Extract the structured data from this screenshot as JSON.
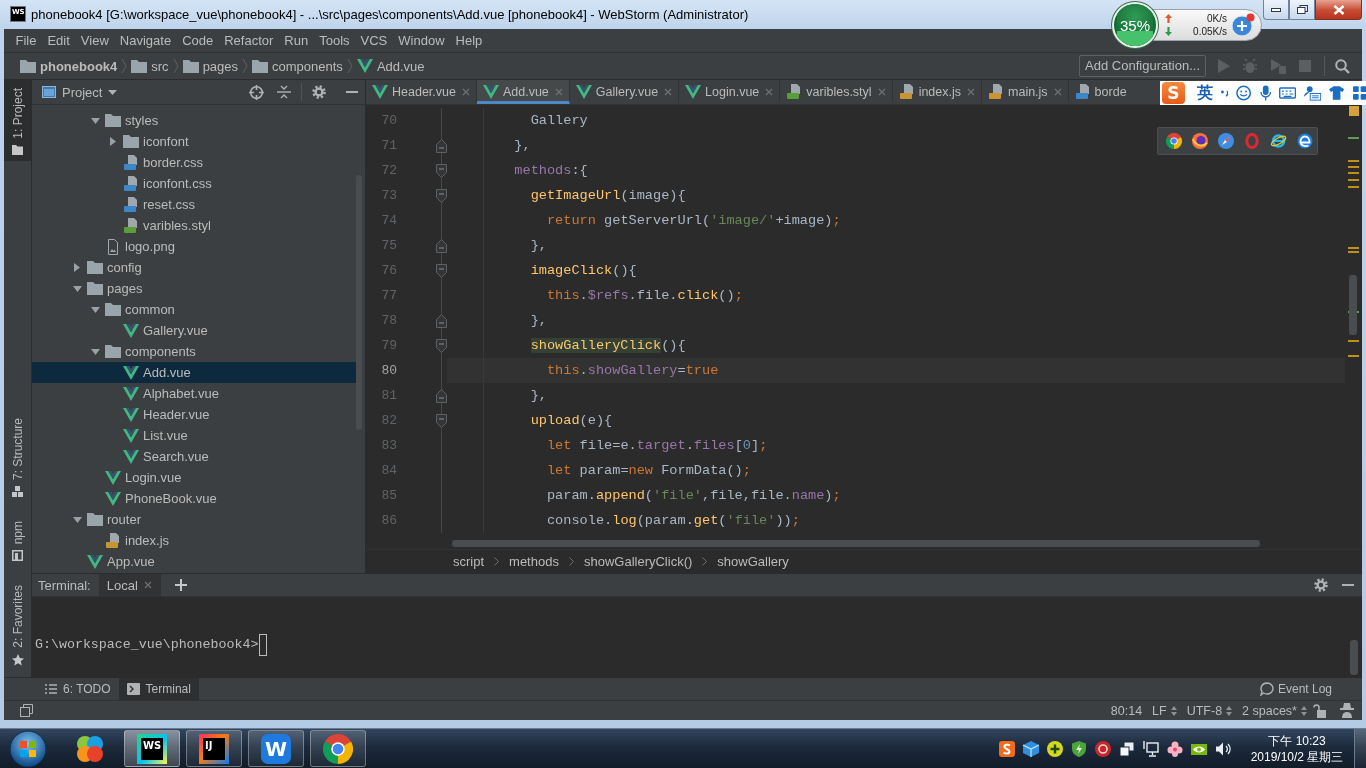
{
  "window": {
    "app_logo": "WS",
    "title": "phonebook4 [G:\\workspace_vue\\phonebook4] - ...\\src\\pages\\components\\Add.vue [phonebook4] - WebStorm (Administrator)"
  },
  "network_monitor": {
    "usage": "35%",
    "level": 0.35,
    "upload": "0K/s",
    "download": "0.05K/s"
  },
  "menu": [
    "File",
    "Edit",
    "View",
    "Navigate",
    "Code",
    "Refactor",
    "Run",
    "Tools",
    "VCS",
    "Window",
    "Help"
  ],
  "navigation_bar": {
    "breadcrumbs": [
      {
        "label": "phonebook4",
        "kind": "project"
      },
      {
        "label": "src",
        "kind": "folder"
      },
      {
        "label": "pages",
        "kind": "folder"
      },
      {
        "label": "components",
        "kind": "folder"
      },
      {
        "label": "Add.vue",
        "kind": "vue"
      }
    ],
    "run_configuration": "Add Configuration..."
  },
  "left_stripe": {
    "top": [
      {
        "label": "1: Project",
        "kind": "project",
        "selected": true
      }
    ],
    "bottom": [
      {
        "label": "7: Structure",
        "kind": "structure",
        "selected": false
      },
      {
        "label": "npm",
        "kind": "npm",
        "selected": false
      },
      {
        "label": "2: Favorites",
        "kind": "favorites",
        "selected": false
      }
    ]
  },
  "project_panel": {
    "title": "Project",
    "tree": [
      {
        "children": [
          {
            "label": "styles",
            "kind": "folder",
            "expanded": true,
            "selected": false,
            "children": [
              {
                "label": "iconfont",
                "kind": "folder",
                "expanded": false,
                "selected": false
              },
              {
                "label": "border.css",
                "kind": "css",
                "selected": false
              },
              {
                "label": "iconfont.css",
                "kind": "css",
                "selected": false
              },
              {
                "label": "reset.css",
                "kind": "css",
                "selected": false
              },
              {
                "label": "varibles.styl",
                "kind": "styl",
                "selected": false
              }
            ]
          },
          {
            "label": "logo.png",
            "kind": "image",
            "selected": false
          }
        ]
      },
      {
        "label": "config",
        "kind": "folder",
        "expanded": false,
        "selected": false
      },
      {
        "label": "pages",
        "kind": "folder",
        "expanded": true,
        "selected": false,
        "children": [
          {
            "label": "common",
            "kind": "folder",
            "expanded": true,
            "selected": false,
            "children": [
              {
                "label": "Gallery.vue",
                "kind": "vue",
                "selected": false
              }
            ]
          },
          {
            "label": "components",
            "kind": "folder",
            "expanded": true,
            "selected": false,
            "children": [
              {
                "label": "Add.vue",
                "kind": "vue",
                "selected": true
              },
              {
                "label": "Alphabet.vue",
                "kind": "vue",
                "selected": false
              },
              {
                "label": "Header.vue",
                "kind": "vue",
                "selected": false
              },
              {
                "label": "List.vue",
                "kind": "vue",
                "selected": false
              },
              {
                "label": "Search.vue",
                "kind": "vue",
                "selected": false
              }
            ]
          },
          {
            "label": "Login.vue",
            "kind": "vue",
            "selected": false
          },
          {
            "label": "PhoneBook.vue",
            "kind": "vue",
            "selected": false
          }
        ]
      },
      {
        "label": "router",
        "kind": "folder",
        "expanded": true,
        "selected": false,
        "children": [
          {
            "label": "index.js",
            "kind": "js",
            "selected": false
          }
        ]
      },
      {
        "label": "App.vue",
        "kind": "vue",
        "selected": false
      }
    ]
  },
  "editor": {
    "tabs": [
      {
        "label": "Header.vue",
        "kind": "vue",
        "selected": false
      },
      {
        "label": "Add.vue",
        "kind": "vue",
        "selected": true
      },
      {
        "label": "Gallery.vue",
        "kind": "vue",
        "selected": false
      },
      {
        "label": "Login.vue",
        "kind": "vue",
        "selected": false
      },
      {
        "label": "varibles.styl",
        "kind": "styl",
        "selected": false
      },
      {
        "label": "index.js",
        "kind": "js",
        "selected": false
      },
      {
        "label": "main.js",
        "kind": "js",
        "selected": false
      },
      {
        "label": "borde",
        "kind": "css",
        "selected": false
      }
    ],
    "lines": [
      {
        "number": "70",
        "kind": "plain",
        "current": false,
        "tokens": [
          {
            "text": "    Gallery",
            "kind": "plain"
          }
        ]
      },
      {
        "number": "71",
        "kind": "close",
        "current": false,
        "tokens": [
          {
            "text": "  },",
            "kind": "plain"
          }
        ]
      },
      {
        "number": "72",
        "kind": "open",
        "current": false,
        "tokens": [
          {
            "text": "  methods",
            "kind": "member"
          },
          {
            "text": ":{",
            "kind": "plain"
          }
        ]
      },
      {
        "number": "73",
        "kind": "open",
        "current": false,
        "tokens": [
          {
            "text": "    getImageUrl",
            "kind": "method"
          },
          {
            "text": "(image){",
            "kind": "plain"
          }
        ]
      },
      {
        "number": "74",
        "kind": "plain",
        "current": false,
        "tokens": [
          {
            "text": "      return",
            "kind": "keyword"
          },
          {
            "text": " getServerUrl(",
            "kind": "plain"
          },
          {
            "text": "'image/'",
            "kind": "string"
          },
          {
            "text": "+image)",
            "kind": "plain"
          },
          {
            "text": ";",
            "kind": "keyword"
          }
        ]
      },
      {
        "number": "75",
        "kind": "close",
        "current": false,
        "tokens": [
          {
            "text": "    },",
            "kind": "plain"
          }
        ]
      },
      {
        "number": "76",
        "kind": "open",
        "current": false,
        "tokens": [
          {
            "text": "    imageClick",
            "kind": "method"
          },
          {
            "text": "(){",
            "kind": "plain"
          }
        ]
      },
      {
        "number": "77",
        "kind": "plain",
        "current": false,
        "tokens": [
          {
            "text": "      this",
            "kind": "keyword"
          },
          {
            "text": ".",
            "kind": "plain"
          },
          {
            "text": "$refs",
            "kind": "member"
          },
          {
            "text": ".file.",
            "kind": "plain"
          },
          {
            "text": "click",
            "kind": "method"
          },
          {
            "text": "()",
            "kind": "plain"
          },
          {
            "text": ";",
            "kind": "keyword"
          }
        ]
      },
      {
        "number": "78",
        "kind": "close",
        "current": false,
        "tokens": [
          {
            "text": "    },",
            "kind": "plain"
          }
        ]
      },
      {
        "number": "79",
        "kind": "open",
        "current": false,
        "tokens": [
          {
            "text": "    showGalleryClick",
            "kind": "usage"
          },
          {
            "text": "(){",
            "kind": "plain"
          }
        ]
      },
      {
        "number": "80",
        "kind": "plain",
        "current": true,
        "tokens": [
          {
            "text": "      this",
            "kind": "keyword"
          },
          {
            "text": ".",
            "kind": "plain"
          },
          {
            "text": "showGallery",
            "kind": "member"
          },
          {
            "text": "=",
            "kind": "plain"
          },
          {
            "text": "true",
            "kind": "keyword"
          }
        ]
      },
      {
        "number": "81",
        "kind": "close",
        "current": false,
        "tokens": [
          {
            "text": "    },",
            "kind": "plain"
          }
        ]
      },
      {
        "number": "82",
        "kind": "open",
        "current": false,
        "tokens": [
          {
            "text": "    upload",
            "kind": "method"
          },
          {
            "text": "(e){",
            "kind": "plain"
          }
        ]
      },
      {
        "number": "83",
        "kind": "plain",
        "current": false,
        "tokens": [
          {
            "text": "      let",
            "kind": "keyword"
          },
          {
            "text": " file=e.",
            "kind": "plain"
          },
          {
            "text": "target",
            "kind": "member"
          },
          {
            "text": ".",
            "kind": "plain"
          },
          {
            "text": "files",
            "kind": "member"
          },
          {
            "text": "[",
            "kind": "plain"
          },
          {
            "text": "0",
            "kind": "number"
          },
          {
            "text": "]",
            "kind": "plain"
          },
          {
            "text": ";",
            "kind": "keyword"
          }
        ]
      },
      {
        "number": "84",
        "kind": "plain",
        "current": false,
        "tokens": [
          {
            "text": "      let",
            "kind": "keyword"
          },
          {
            "text": " param=",
            "kind": "plain"
          },
          {
            "text": "new",
            "kind": "keyword"
          },
          {
            "text": " FormData()",
            "kind": "plain"
          },
          {
            "text": ";",
            "kind": "keyword"
          }
        ]
      },
      {
        "number": "85",
        "kind": "plain",
        "current": false,
        "tokens": [
          {
            "text": "      param.",
            "kind": "plain"
          },
          {
            "text": "append",
            "kind": "method"
          },
          {
            "text": "(",
            "kind": "plain"
          },
          {
            "text": "'file'",
            "kind": "string"
          },
          {
            "text": ",file,file.",
            "kind": "plain"
          },
          {
            "text": "name",
            "kind": "member"
          },
          {
            "text": ")",
            "kind": "plain"
          },
          {
            "text": ";",
            "kind": "keyword"
          }
        ]
      },
      {
        "number": "86",
        "kind": "plain",
        "current": false,
        "tokens": [
          {
            "text": "      console.",
            "kind": "plain"
          },
          {
            "text": "log",
            "kind": "method"
          },
          {
            "text": "(param.",
            "kind": "plain"
          },
          {
            "text": "get",
            "kind": "method"
          },
          {
            "text": "(",
            "kind": "plain"
          },
          {
            "text": "'file'",
            "kind": "string"
          },
          {
            "text": "))",
            "kind": "plain"
          },
          {
            "text": ";",
            "kind": "keyword"
          }
        ]
      }
    ],
    "breadcrumbs": [
      "script",
      "methods",
      "showGalleryClick()",
      "showGallery"
    ]
  },
  "input_method_bar": {
    "logo": "S",
    "mode": "英"
  },
  "terminal": {
    "title": "Terminal:",
    "tabs": [
      {
        "label": "Local",
        "selected": true
      }
    ],
    "prompt": "G:\\workspace_vue\\phonebook4>"
  },
  "tool_window_bar": {
    "tabs": [
      {
        "label": "6: TODO",
        "kind": "todo",
        "selected": false
      },
      {
        "label": "Terminal",
        "kind": "terminal",
        "selected": true
      }
    ],
    "event_log": "Event Log"
  },
  "status_bar": [
    {
      "text": "80:14",
      "kind": "position"
    },
    {
      "text": "LF",
      "kind": "selector"
    },
    {
      "text": "UTF-8",
      "kind": "selector"
    },
    {
      "text": "2 spaces*",
      "kind": "selector"
    }
  ],
  "taskbar": {
    "apps": [
      {
        "kind": "pinwheel",
        "running": false,
        "selected": false
      },
      {
        "kind": "ws",
        "logo": "WS",
        "running": true,
        "selected": true
      },
      {
        "kind": "ij",
        "logo": "IJ",
        "running": true,
        "selected": false
      },
      {
        "kind": "wps",
        "logo": "W",
        "running": true,
        "selected": false
      },
      {
        "kind": "chrome",
        "running": true,
        "selected": false
      }
    ],
    "clock": {
      "time": "下午 10:23",
      "date": "2019/10/2 星期三"
    }
  }
}
